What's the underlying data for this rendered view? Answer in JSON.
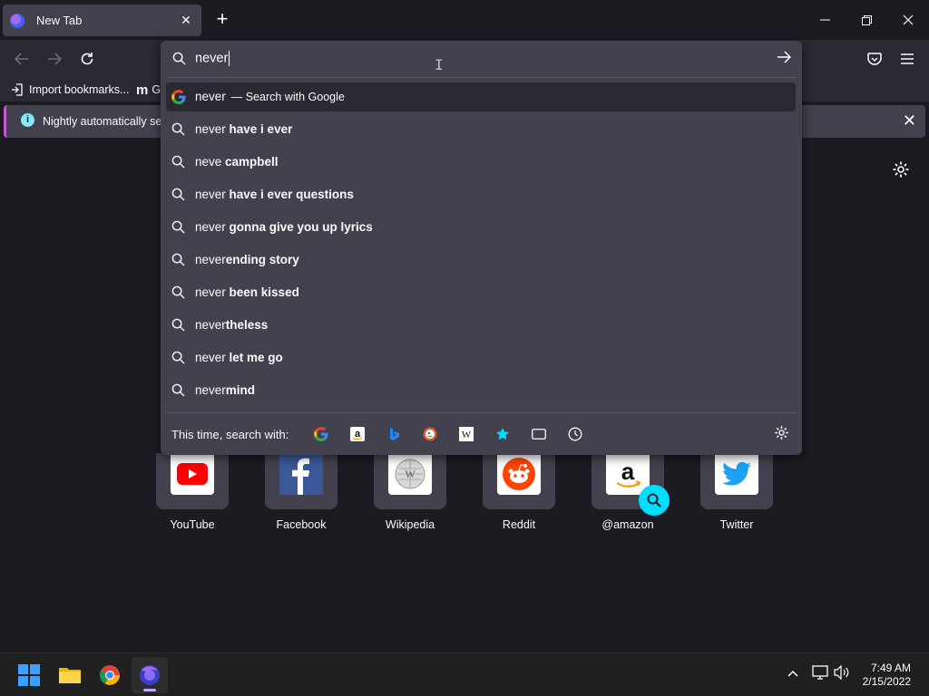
{
  "browser": {
    "tab": {
      "title": "New Tab"
    },
    "window_controls": {
      "minimize": "—",
      "restore": "❐",
      "close": "✕"
    }
  },
  "bookmarks": {
    "import_label": "Import bookmarks...",
    "second_label": "G"
  },
  "notification": {
    "text": "Nightly automatically sends some data to Mozilla so that we can improve your experience."
  },
  "urlbar": {
    "value": "never",
    "suggestions": [
      {
        "prefix": "never",
        "suffix": "",
        "sub": "— Search with Google",
        "icon": "google-icon",
        "selected": true
      },
      {
        "prefix": "never",
        "suffix": " have i ever",
        "icon": "search-icon"
      },
      {
        "prefix": "neve",
        "suffix": " campbell",
        "icon": "search-icon"
      },
      {
        "prefix": "never",
        "suffix": " have i ever questions",
        "icon": "search-icon"
      },
      {
        "prefix": "never",
        "suffix": " gonna give you up lyrics",
        "icon": "search-icon"
      },
      {
        "prefix": "never",
        "suffix": "ending story",
        "icon": "search-icon"
      },
      {
        "prefix": "never",
        "suffix": " been kissed",
        "icon": "search-icon"
      },
      {
        "prefix": "never",
        "suffix": "theless",
        "icon": "search-icon"
      },
      {
        "prefix": "never",
        "suffix": " let me go",
        "icon": "search-icon"
      },
      {
        "prefix": "never",
        "suffix": "mind",
        "icon": "search-icon"
      }
    ],
    "oneoff_label": "This time, search with:",
    "oneoff_engines": [
      "google-icon",
      "amazon-icon",
      "bing-icon",
      "duckduckgo-icon",
      "wikipedia-icon",
      "bookmarks-star-icon",
      "tabs-icon",
      "history-icon"
    ]
  },
  "shortcuts": [
    {
      "label": "YouTube",
      "icon": "youtube-icon"
    },
    {
      "label": "Facebook",
      "icon": "facebook-icon"
    },
    {
      "label": "Wikipedia",
      "icon": "wikipedia-icon"
    },
    {
      "label": "Reddit",
      "icon": "reddit-icon"
    },
    {
      "label": "@amazon",
      "icon": "amazon-icon"
    },
    {
      "label": "Twitter",
      "icon": "twitter-icon"
    }
  ],
  "taskbar": {
    "time": "7:49 AM",
    "date": "2/15/2022"
  },
  "colors": {
    "accent": "#00ddff",
    "notification_bar_edge": "#c957d6"
  }
}
